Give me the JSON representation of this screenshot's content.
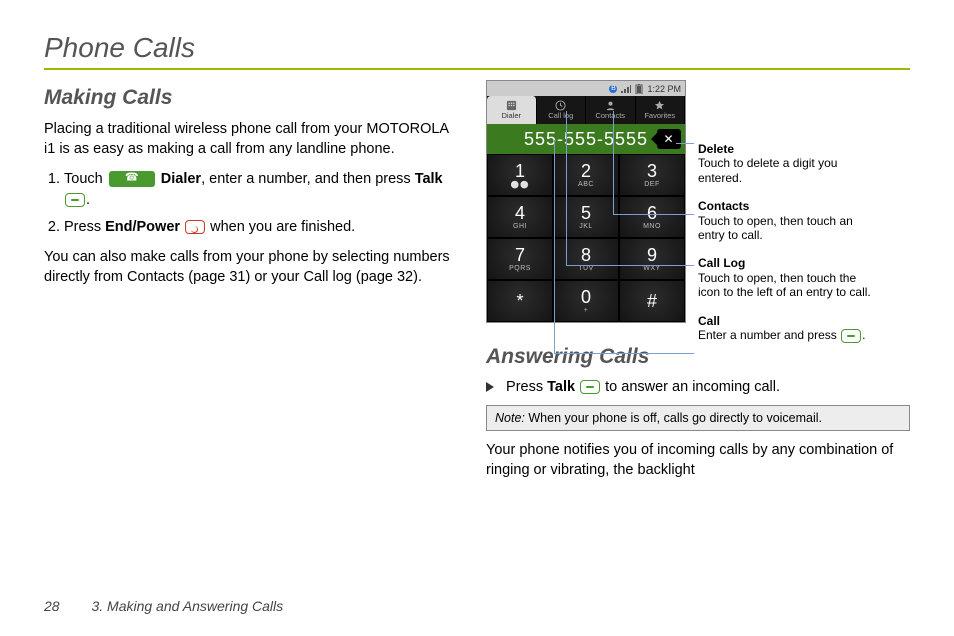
{
  "page_title": "Phone Calls",
  "footer": {
    "page_number": "28",
    "chapter": "3. Making and Answering Calls"
  },
  "left": {
    "heading": "Making Calls",
    "intro": "Placing a traditional wireless phone call from your MOTOROLA i1 is as easy as making a call from any landline phone.",
    "steps": {
      "s1_a": "Touch ",
      "s1_dialer": "Dialer",
      "s1_b": ", enter a number, and then press ",
      "s1_talk": "Talk",
      "s1_c": ".",
      "s2_a": "Press ",
      "s2_end": "End/Power",
      "s2_b": " when you are finished."
    },
    "outro": "You can also make calls from your phone by selecting numbers directly from Contacts (page 31) or your Call log (page 32)."
  },
  "phone": {
    "status_time": "1:22 PM",
    "tabs": {
      "dialer": "Dialer",
      "calllog": "Call log",
      "contacts": "Contacts",
      "favorites": "Favorites"
    },
    "display_number": "555-555-5555",
    "delete_glyph": "✕",
    "keys": [
      {
        "d": "1",
        "l": " "
      },
      {
        "d": "2",
        "l": "ABC"
      },
      {
        "d": "3",
        "l": "DEF"
      },
      {
        "d": "4",
        "l": "GHI"
      },
      {
        "d": "5",
        "l": "JKL"
      },
      {
        "d": "6",
        "l": "MNO"
      },
      {
        "d": "7",
        "l": "PQRS"
      },
      {
        "d": "8",
        "l": "TUV"
      },
      {
        "d": "9",
        "l": "WXY"
      },
      {
        "d": "*",
        "l": ""
      },
      {
        "d": "0",
        "l": "+"
      },
      {
        "d": "#",
        "l": ""
      }
    ]
  },
  "callouts": {
    "delete_t": "Delete",
    "delete_b": "Touch to delete a digit you entered.",
    "contacts_t": "Contacts",
    "contacts_b": "Touch to open, then touch an entry to call.",
    "calllog_t": "Call Log",
    "calllog_b": "Touch to open, then touch the icon to the left of an entry to call.",
    "call_t": "Call",
    "call_b_a": "Enter a number and press ",
    "call_b_c": "."
  },
  "answering": {
    "heading": "Answering Calls",
    "line_a": "Press ",
    "line_talk": "Talk",
    "line_b": " to answer an incoming call.",
    "note_label": "Note:",
    "note_body": " When your phone is off, calls go directly to voicemail.",
    "para": "Your phone notifies you of incoming calls by any combination of ringing or vibrating, the backlight"
  }
}
